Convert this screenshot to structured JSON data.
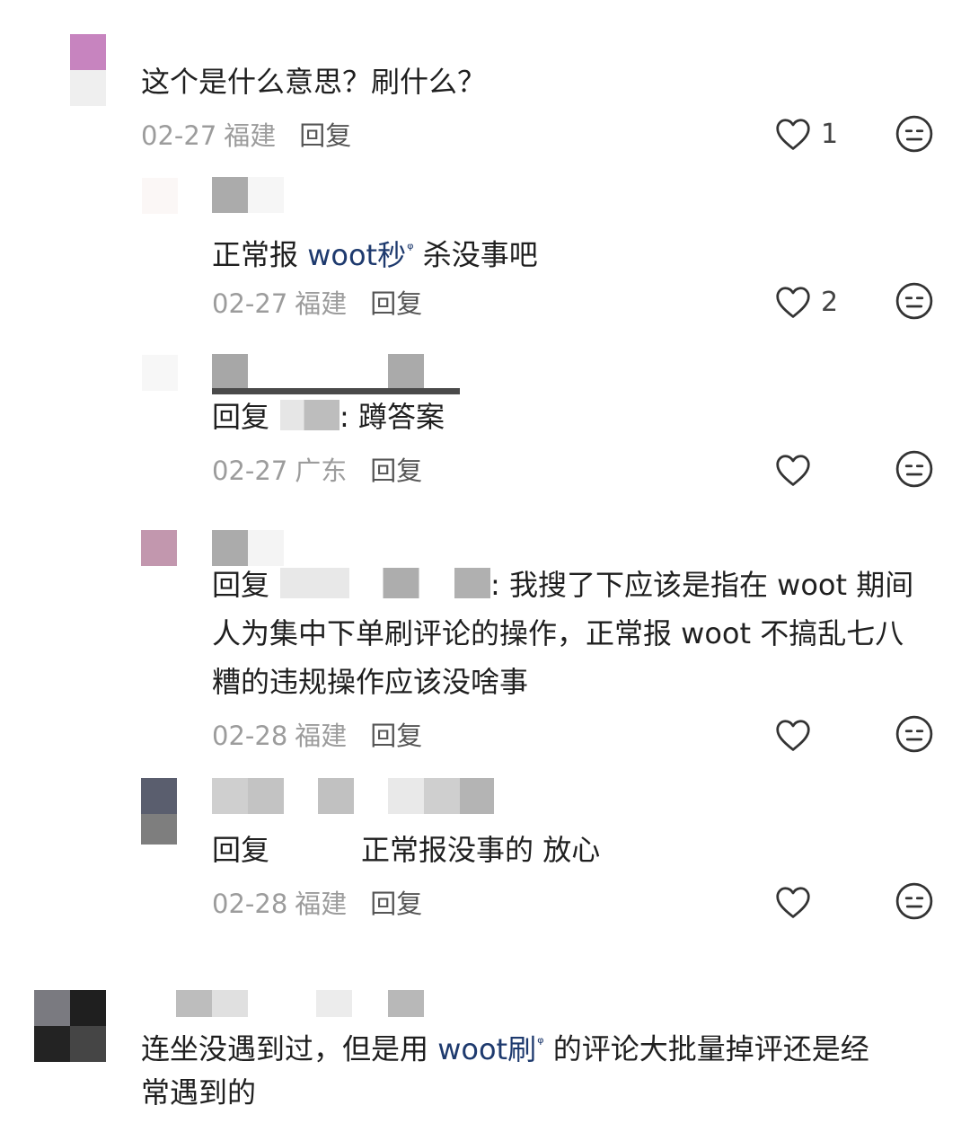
{
  "comments": [
    {
      "text": "这个是什么意思？刷什么？",
      "date": "02-27",
      "region": "福建",
      "reply_label": "回复",
      "like_count": "1"
    },
    {
      "text_before": "正常报 ",
      "link": "woot秒",
      "text_after": " 杀没事吧",
      "date": "02-27",
      "region": "福建",
      "reply_label": "回复",
      "like_count": "2"
    },
    {
      "reply_prefix": "回复",
      "text": ": 蹲答案",
      "date": "02-27",
      "region": "广东",
      "reply_label": "回复",
      "like_count": ""
    },
    {
      "reply_prefix": "回复",
      "line1": ": 我搜了下应该是指在 woot 期间",
      "line2": "人为集中下单刷评论的操作，正常报 woot 不搞乱七八",
      "line3": "糟的违规操作应该没啥事",
      "date": "02-28",
      "region": "福建",
      "reply_label": "回复",
      "like_count": ""
    },
    {
      "reply_prefix": "回复",
      "text": "正常报没事的 放心",
      "date": "02-28",
      "region": "福建",
      "reply_label": "回复",
      "like_count": ""
    },
    {
      "text_before": "连坐没遇到过，但是用 ",
      "link": "woot刷",
      "text_after": " 的评论大批量掉评还是经",
      "line2": "常遇到的"
    }
  ],
  "icons": {
    "like": "heart-outline-icon",
    "emoji": "meh-face-icon",
    "search": "search-icon"
  },
  "colors": {
    "text": "#1f1f1f",
    "meta": "#9c9c9c",
    "link": "#1e3a6e",
    "icon": "#333333"
  }
}
